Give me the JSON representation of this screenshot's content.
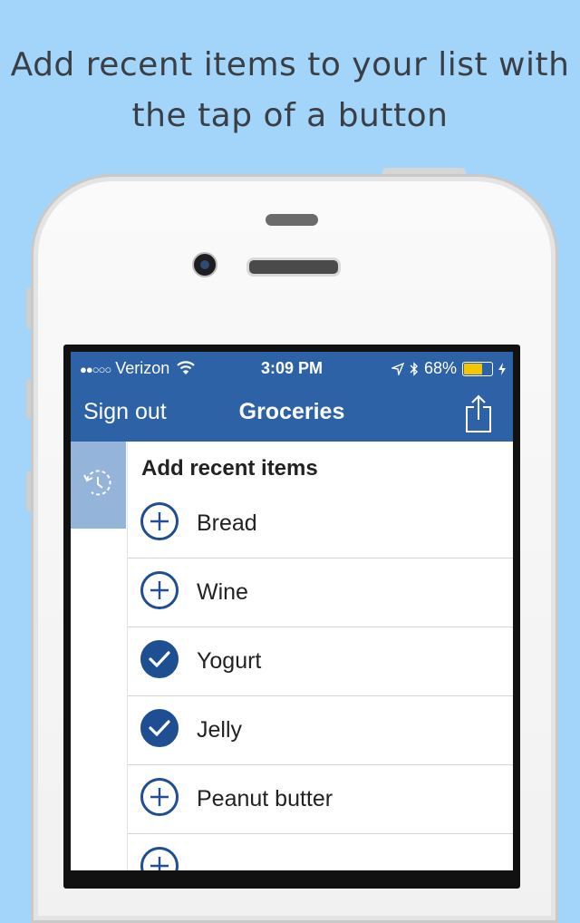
{
  "headline": {
    "line1": "Add recent items to your list with",
    "line2": "the tap of a button"
  },
  "status_bar": {
    "signal": "●●○○○",
    "carrier": "Verizon",
    "time": "3:09 PM",
    "battery_percent": "68%",
    "battery_level": 0.68,
    "battery_color": "#f5c500"
  },
  "nav_bar": {
    "left_button": "Sign out",
    "title": "Groceries",
    "right_icon": "share-icon",
    "color": "#2d63a6"
  },
  "sidebar": {
    "icon": "history-icon"
  },
  "recent_list": {
    "header": "Add recent items",
    "items": [
      {
        "label": "Bread",
        "state": "add"
      },
      {
        "label": "Wine",
        "state": "add"
      },
      {
        "label": "Yogurt",
        "state": "added"
      },
      {
        "label": "Jelly",
        "state": "added"
      },
      {
        "label": "Peanut butter",
        "state": "add"
      },
      {
        "label": "",
        "state": "add"
      }
    ],
    "accent": "#1e4f93"
  }
}
